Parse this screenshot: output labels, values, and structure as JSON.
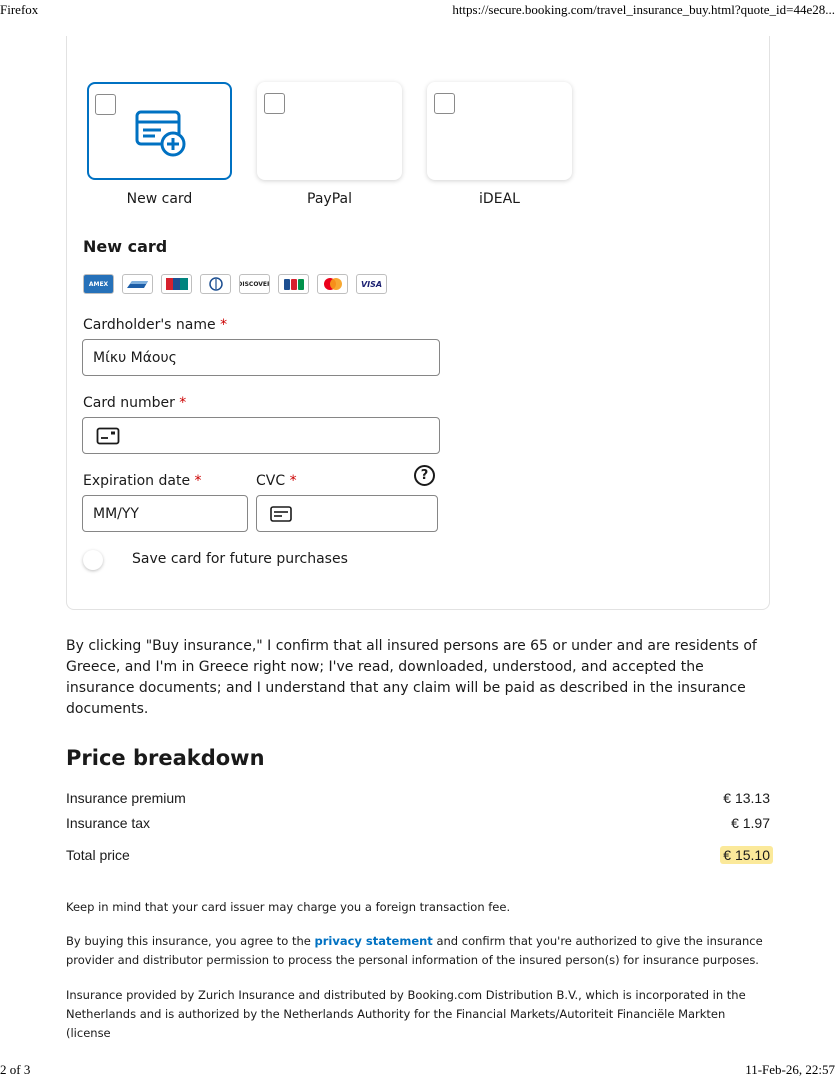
{
  "print_header": {
    "browser": "Firefox",
    "url": "https://secure.booking.com/travel_insurance_buy.html?quote_id=44e28..."
  },
  "print_footer": {
    "page": "2 of 3",
    "datetime": "11-Feb-26, 22:57"
  },
  "payment_methods": [
    {
      "label": "New card",
      "selected": true
    },
    {
      "label": "PayPal",
      "selected": false
    },
    {
      "label": "iDEAL",
      "selected": false
    }
  ],
  "new_card": {
    "title": "New card",
    "brands": [
      "AMEX",
      "card",
      "UnionPay",
      "Diners Club",
      "DISCOVER",
      "JCB",
      "mastercard",
      "VISA"
    ],
    "cardholder_label": "Cardholder's name",
    "cardholder_value": "Μίκυ Μάους",
    "card_number_label": "Card number",
    "card_number_value": "",
    "expiration_label": "Expiration date",
    "expiration_placeholder": "MM/YY",
    "cvc_label": "CVC",
    "cvc_value": "",
    "required_mark": "*",
    "help_glyph": "?",
    "save_card_label": "Save card for future purchases"
  },
  "consent_text": "By clicking \"Buy insurance,\" I confirm that all insured persons are 65 or under and are residents of Greece, and I'm in Greece right now; I've read, downloaded, understood, and accepted the insurance documents; and I understand that any claim will be paid as described in the insurance documents.",
  "price_breakdown": {
    "title": "Price breakdown",
    "rows": [
      {
        "label": "Insurance premium",
        "amount": "€ 13.13"
      },
      {
        "label": "Insurance tax",
        "amount": "€ 1.97"
      }
    ],
    "total_label": "Total price",
    "total_amount": "€ 15.10"
  },
  "notes": {
    "fee_note": "Keep in mind that your card issuer may charge you a foreign transaction fee.",
    "privacy_before": "By buying this insurance, you agree to the ",
    "privacy_link": "privacy statement",
    "privacy_after": " and confirm that you're authorized to give the insurance provider and distributor permission to process the personal information of the insured person(s) for insurance purposes.",
    "provider_note": "Insurance provided by Zurich Insurance and distributed by Booking.com Distribution B.V., which is incorporated in the Netherlands and is authorized by the Netherlands Authority for the Financial Markets/Autoriteit Financiële Markten (license"
  },
  "colors": {
    "accent": "#0071c2",
    "highlight": "#fbe99a",
    "required": "#cc0000"
  }
}
